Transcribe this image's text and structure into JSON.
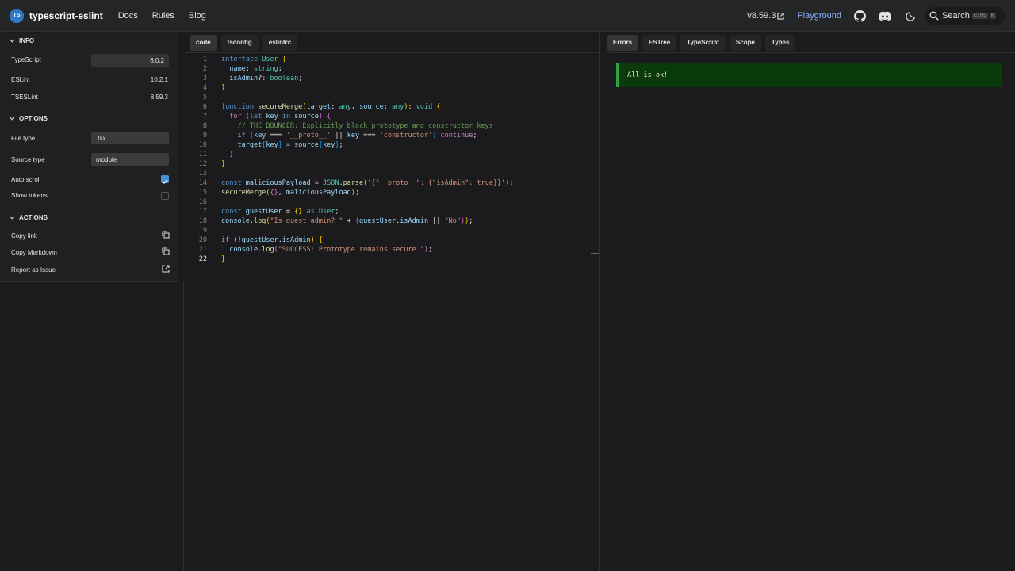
{
  "navbar": {
    "brand": "typescript-eslint",
    "logo_text": "TS",
    "links": [
      "Docs",
      "Rules",
      "Blog"
    ],
    "version": "v8.59.3",
    "playground": "Playground",
    "search_label": "Search",
    "search_kbd": [
      "CTRL",
      "K"
    ],
    "accent_color": "#8ab4ff"
  },
  "sidebar": {
    "info_title": "INFO",
    "typescript_label": "TypeScript",
    "typescript_value": "6.0.2",
    "eslint_label": "ESLint",
    "eslint_value": "10.2.1",
    "tseslint_label": "TSESLint",
    "tseslint_value": "8.59.3",
    "options_title": "OPTIONS",
    "filetype_label": "File type",
    "filetype_value": ".tsx",
    "sourcetype_label": "Source type",
    "sourcetype_value": "module",
    "autoscroll_label": "Auto scroll",
    "autoscroll_checked": true,
    "showtokens_label": "Show tokens",
    "showtokens_checked": false,
    "actions_title": "ACTIONS",
    "copy_link": "Copy link",
    "copy_markdown": "Copy Markdown",
    "report_issue": "Report as Issue"
  },
  "editor": {
    "tabs": [
      "code",
      "tsconfig",
      "eslintrc"
    ],
    "active_tab": "code",
    "current_line": 22
  },
  "right_panel": {
    "tabs": [
      "Errors",
      "ESTree",
      "TypeScript",
      "Scope",
      "Types"
    ],
    "active_tab": "Errors",
    "message": "All is ok!",
    "message_color": "#0a3a0a"
  }
}
